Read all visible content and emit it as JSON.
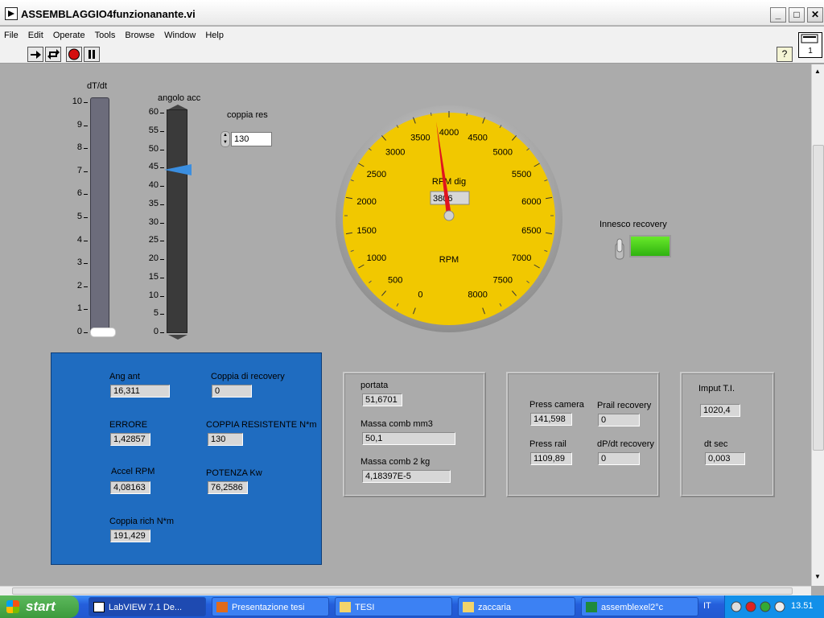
{
  "window": {
    "title": "ASSEMBLAGGIO4funzionanante.vi",
    "controls": {
      "minimize": "_",
      "maximize": "□",
      "close": "✕"
    }
  },
  "menu": [
    {
      "id": "file",
      "label": "File"
    },
    {
      "id": "edit",
      "label": "Edit"
    },
    {
      "id": "operate",
      "label": "Operate"
    },
    {
      "id": "tools",
      "label": "Tools"
    },
    {
      "id": "browse",
      "label": "Browse"
    },
    {
      "id": "window",
      "label": "Window"
    },
    {
      "id": "help",
      "label": "Help"
    }
  ],
  "toolbar": {
    "help_label": "?",
    "vi_icon_label": "1"
  },
  "dtdt": {
    "label": "dT/dt",
    "ticks": [
      "10",
      "9",
      "8",
      "7",
      "6",
      "5",
      "4",
      "3",
      "2",
      "1",
      "0"
    ],
    "value": 0
  },
  "angolo": {
    "label": "angolo acc",
    "ticks": [
      "60",
      "55",
      "50",
      "45",
      "40",
      "35",
      "30",
      "25",
      "20",
      "15",
      "10",
      "5",
      "0"
    ],
    "value": 45
  },
  "coppia_res": {
    "label": "coppia res",
    "value": "130"
  },
  "gauge": {
    "min": 0,
    "max": 8000,
    "ticks": [
      "0",
      "500",
      "1000",
      "1500",
      "2000",
      "2500",
      "3000",
      "3500",
      "4000",
      "4500",
      "5000",
      "5500",
      "6000",
      "6500",
      "7000",
      "7500",
      "8000"
    ],
    "value": 3806,
    "unit_label": "RPM",
    "digital_label": "RPM dig",
    "digital_value": "3806",
    "face_color": "#f1c800",
    "needle_color": "#e0141e"
  },
  "innesco": {
    "label": "Innesco recovery",
    "led_color": "#4ad11a"
  },
  "blue_panel": {
    "color": "#1f6cc0",
    "fields": [
      {
        "label": "Ang ant",
        "value": "16,311"
      },
      {
        "label": "Coppia di recovery",
        "value": "0"
      },
      {
        "label": "ERRORE",
        "value": "1,42857"
      },
      {
        "label": "COPPIA RESISTENTE N*m",
        "value": "130"
      },
      {
        "label": "Accel RPM",
        "value": "4,08163"
      },
      {
        "label": "POTENZA Kw",
        "value": "76,2586"
      },
      {
        "label": "Coppia rich N*m",
        "value": "191,429"
      }
    ]
  },
  "frame1": {
    "fields": [
      {
        "label": "portata",
        "value": "51,6701"
      },
      {
        "label": "Massa comb mm3",
        "value": "50,1"
      },
      {
        "label": "Massa comb 2 kg",
        "value": "4,18397E-5"
      }
    ]
  },
  "frame2": {
    "fields": [
      {
        "label": "Press camera",
        "value": "141,598"
      },
      {
        "label": "Prail recovery",
        "value": "0"
      },
      {
        "label": "Press rail",
        "value": "1109,89"
      },
      {
        "label": "dP/dt recovery",
        "value": "0"
      }
    ]
  },
  "frame3": {
    "fields": [
      {
        "label": "Imput T.I.",
        "value": "1020,4"
      },
      {
        "label": "dt sec",
        "value": "0,003"
      }
    ]
  },
  "taskbar": {
    "start_label": "start",
    "tasks": [
      {
        "label": "LabVIEW 7.1 De...",
        "icon": "labview-icon"
      },
      {
        "label": "Presentazione tesi",
        "icon": "powerpoint-icon"
      },
      {
        "label": "TESI",
        "icon": "folder-icon"
      },
      {
        "label": "zaccaria",
        "icon": "folder-icon"
      },
      {
        "label": "assemblexel2°c",
        "icon": "excel-icon"
      }
    ],
    "language": "IT",
    "clock": "13.51"
  }
}
